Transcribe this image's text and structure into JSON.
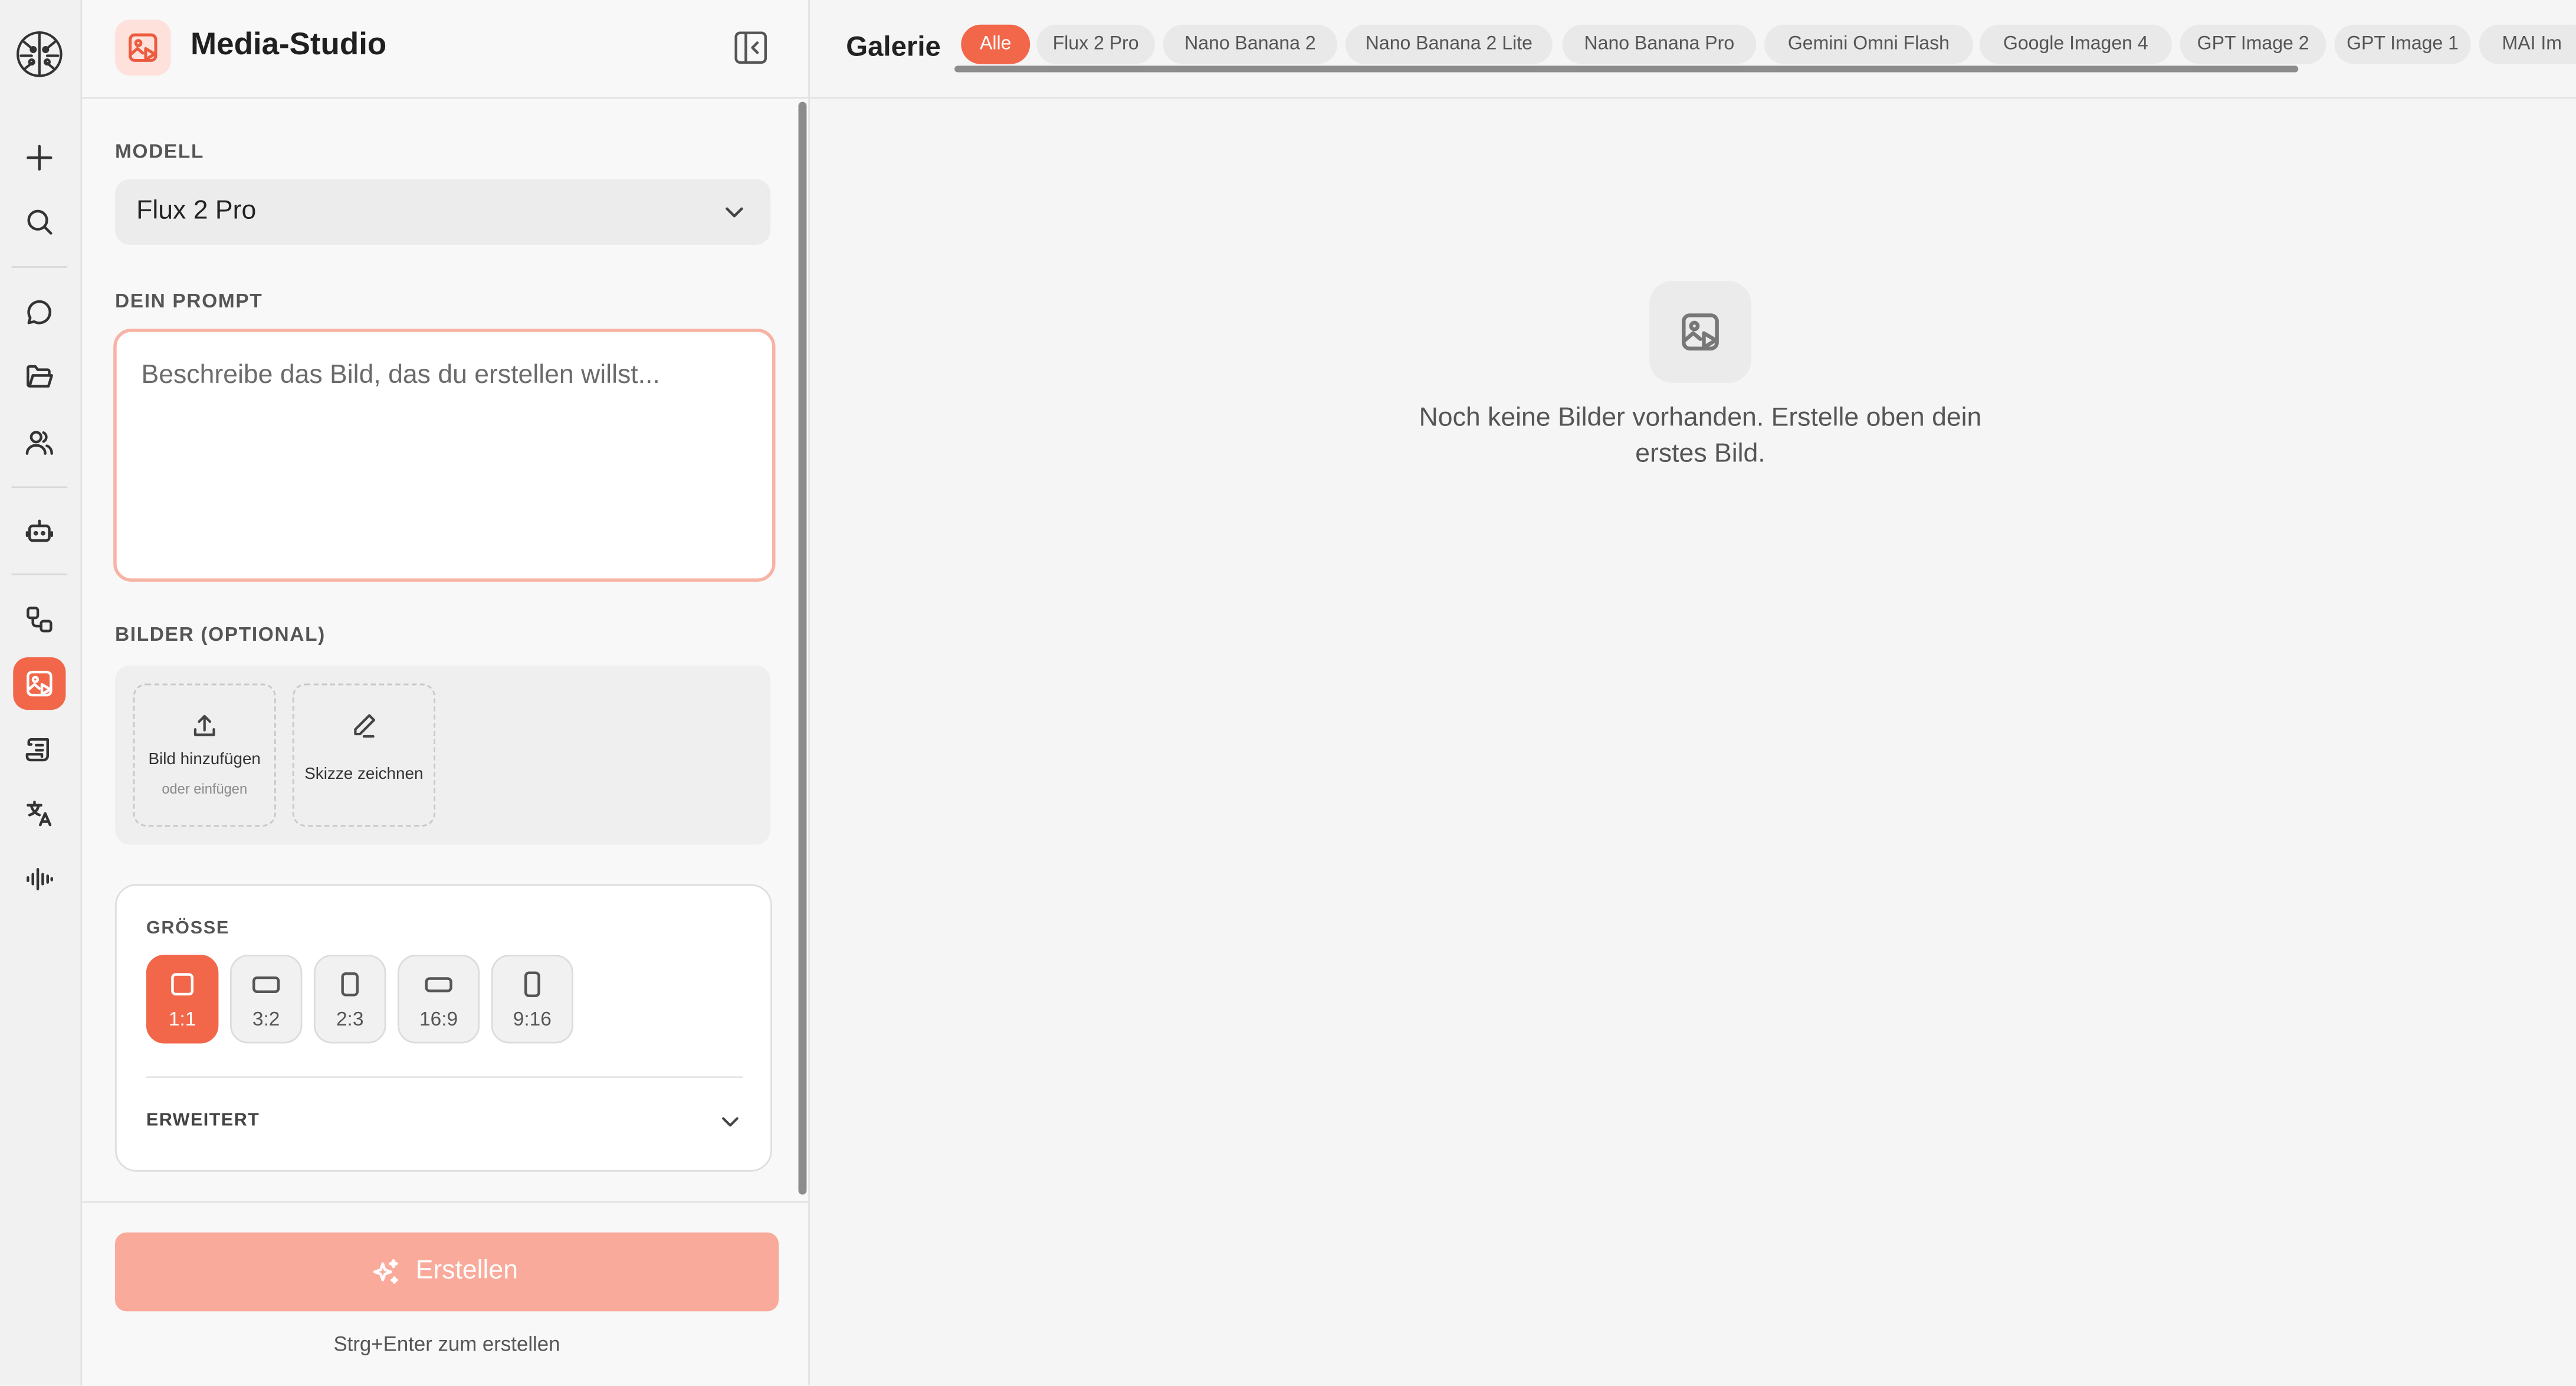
{
  "rail": {
    "items": [
      {
        "name": "app-logo-icon"
      },
      {
        "name": "plus-icon"
      },
      {
        "name": "search-icon"
      },
      {
        "name": "chat-icon"
      },
      {
        "name": "folder-icon"
      },
      {
        "name": "users-icon"
      },
      {
        "name": "robot-icon"
      },
      {
        "name": "workflow-icon"
      },
      {
        "name": "image-studio-icon",
        "active": true
      },
      {
        "name": "scroll-document-icon"
      },
      {
        "name": "translate-icon"
      },
      {
        "name": "audio-waveform-icon"
      }
    ]
  },
  "panel": {
    "title": "Media-Studio",
    "model_label": "MODELL",
    "model_value": "Flux 2 Pro",
    "prompt_label": "DEIN PROMPT",
    "prompt_placeholder": "Beschreibe das Bild, das du erstellen willst...",
    "images_label": "BILDER (OPTIONAL)",
    "add_image_label": "Bild hinzufügen",
    "add_image_sub": "oder einfügen",
    "sketch_label": "Skizze zeichnen",
    "size_label": "GRÖSSE",
    "sizes": [
      {
        "label": "1:1",
        "selected": true
      },
      {
        "label": "3:2"
      },
      {
        "label": "2:3"
      },
      {
        "label": "16:9"
      },
      {
        "label": "9:16"
      }
    ],
    "advanced_label": "ERWEITERT",
    "create_label": "Erstellen",
    "shortcut_hint": "Strg+Enter zum erstellen"
  },
  "gallery": {
    "title": "Galerie",
    "filters": [
      "Alle",
      "Flux 2 Pro",
      "Nano Banana 2",
      "Nano Banana 2 Lite",
      "Nano Banana Pro",
      "Gemini Omni Flash",
      "Google Imagen 4",
      "GPT Image 2",
      "GPT Image 1",
      "MAI Im"
    ],
    "active_filter": "Alle",
    "empty_message": "Noch keine Bilder vorhanden. Erstelle oben dein erstes Bild."
  },
  "colors": {
    "accent": "#f2664a",
    "accent_soft": "#f9aa9a",
    "prompt_border": "#f7b3a3"
  }
}
